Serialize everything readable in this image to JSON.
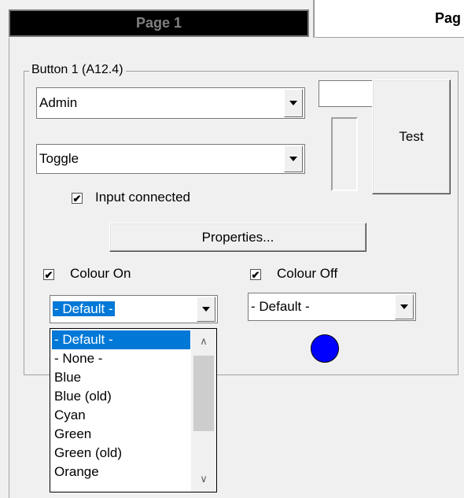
{
  "tabs": [
    {
      "label": "Page 1"
    },
    {
      "label": "Pag"
    }
  ],
  "group": {
    "legend": "Button 1 (A12.4)",
    "user_combo": "Admin",
    "mode_combo": "Toggle",
    "input_connected_label": "Input connected",
    "input_connected_checked": true,
    "properties_label": "Properties...",
    "test_label": "Test",
    "colour_on_label": "Colour On",
    "colour_on_checked": true,
    "colour_off_label": "Colour Off",
    "colour_off_checked": true,
    "colour_on_value": "- Default -",
    "colour_off_value": "- Default -",
    "indicator_color": "#0000ff"
  },
  "dropdown": {
    "items": [
      "- Default -",
      "- None -",
      "Blue",
      "Blue (old)",
      "Cyan",
      "Green",
      "Green (old)",
      "Orange"
    ],
    "selected_index": 0
  },
  "icons": {
    "checkmark": "✔",
    "scroll_up": "∧",
    "scroll_down": "∨"
  }
}
